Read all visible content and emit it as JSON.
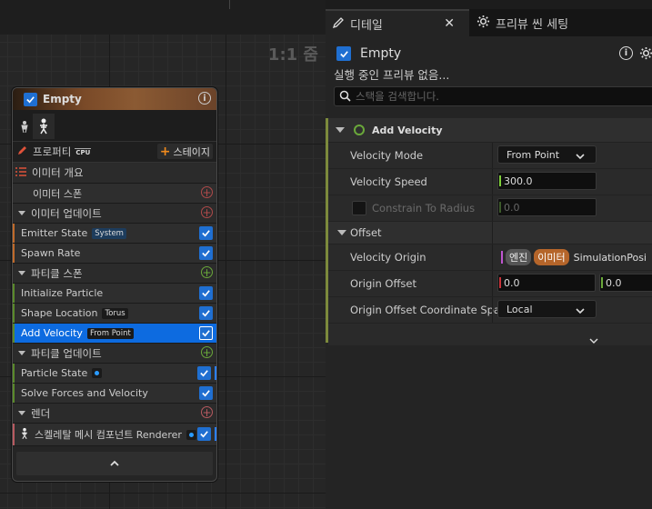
{
  "graph": {
    "zoom": "1:1 줌"
  },
  "node": {
    "title": "Empty",
    "toolbar": {
      "properties_label": "프로퍼티",
      "cpu_label": "CPU",
      "stage_label": "스테이지"
    },
    "overview_label": "이미터 개요",
    "sections": [
      {
        "label": "이미터 스폰"
      },
      {
        "label": "이미터 업데이트",
        "items": [
          {
            "label": "Emitter State",
            "tag": "System"
          },
          {
            "label": "Spawn Rate"
          }
        ]
      },
      {
        "label": "파티클 스폰",
        "items": [
          {
            "label": "Initialize Particle"
          },
          {
            "label": "Shape Location",
            "tag": "Torus"
          },
          {
            "label": "Add Velocity",
            "tag": "From Point"
          }
        ]
      },
      {
        "label": "파티클 업데이트",
        "items": [
          {
            "label": "Particle State"
          },
          {
            "label": "Solve Forces and Velocity"
          }
        ]
      },
      {
        "label": "렌더",
        "items": [
          {
            "label": "스켈레탈 메시 컴포넌트 Renderer"
          }
        ]
      }
    ]
  },
  "colors": {
    "accent": "#0d6be0",
    "spawn": "#f08a1c",
    "particle_spawn": "#7fcf3a",
    "render": "#d3656b"
  },
  "tabs": [
    {
      "label": "디테일"
    },
    {
      "label": "프리뷰 씬 세팅"
    }
  ],
  "details": {
    "object_name": "Empty",
    "preview_status": "실행 중인 프리뷰 없음...",
    "search_placeholder": "스택을 검색합니다.",
    "section_title": "Add Velocity",
    "rows": {
      "velocity_mode": {
        "label": "Velocity Mode",
        "value": "From Point"
      },
      "velocity_speed": {
        "label": "Velocity Speed",
        "value": "300.0"
      },
      "constrain": {
        "label": "Constrain To Radius",
        "value": "0.0"
      },
      "offset": {
        "label": "Offset"
      },
      "velocity_origin": {
        "label": "Velocity Origin",
        "pill1": "엔진",
        "pill2": "이미터",
        "value": "SimulationPosi"
      },
      "origin_offset": {
        "label": "Origin Offset",
        "x": "0.0",
        "y": "0.0"
      },
      "coord_space": {
        "label": "Origin Offset Coordinate Spac",
        "value": "Local"
      }
    }
  }
}
